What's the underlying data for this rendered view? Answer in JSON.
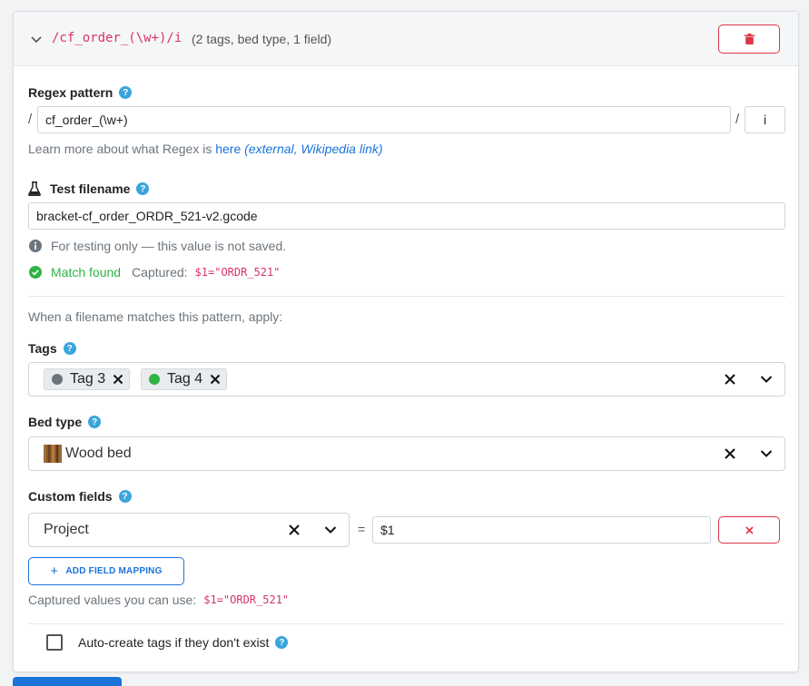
{
  "header": {
    "pattern": "/cf_order_(\\w+)/i",
    "summary": "(2 tags, bed type, 1 field)"
  },
  "regex": {
    "label": "Regex pattern",
    "slash_open": "/",
    "pattern_value": "cf_order_(\\w+)",
    "slash_close": "/",
    "flags_value": "i",
    "learn_text": "Learn more about what Regex is",
    "learn_link": "here",
    "learn_link_ext": "(external, Wikipedia link)"
  },
  "test": {
    "label": "Test filename",
    "value": "bracket-cf_order_ORDR_521-v2.gcode",
    "note": "For testing only — this value is not saved.",
    "match_status": "Match found",
    "captured_label": "Captured:",
    "captured_value": "$1=\"ORDR_521\""
  },
  "apply_text": "When a filename matches this pattern, apply:",
  "tags": {
    "label": "Tags",
    "items": [
      {
        "label": "Tag 3",
        "color": "#6c757d"
      },
      {
        "label": "Tag 4",
        "color": "#2fb344"
      }
    ]
  },
  "bed": {
    "label": "Bed type",
    "value": "Wood bed"
  },
  "custom_fields": {
    "label": "Custom fields",
    "field_name": "Project",
    "equals": "=",
    "field_value": "$1",
    "add_button": "ADD FIELD MAPPING",
    "captured_text": "Captured values you can use:",
    "captured_value": "$1=\"ORDR_521\""
  },
  "auto_create": {
    "label": "Auto-create tags if they don't exist",
    "checked": false
  },
  "colors": {
    "accent": "#1a73d9",
    "danger": "#dc3545",
    "success": "#2fb344",
    "code": "#d6336c",
    "help": "#3aa5dd"
  }
}
